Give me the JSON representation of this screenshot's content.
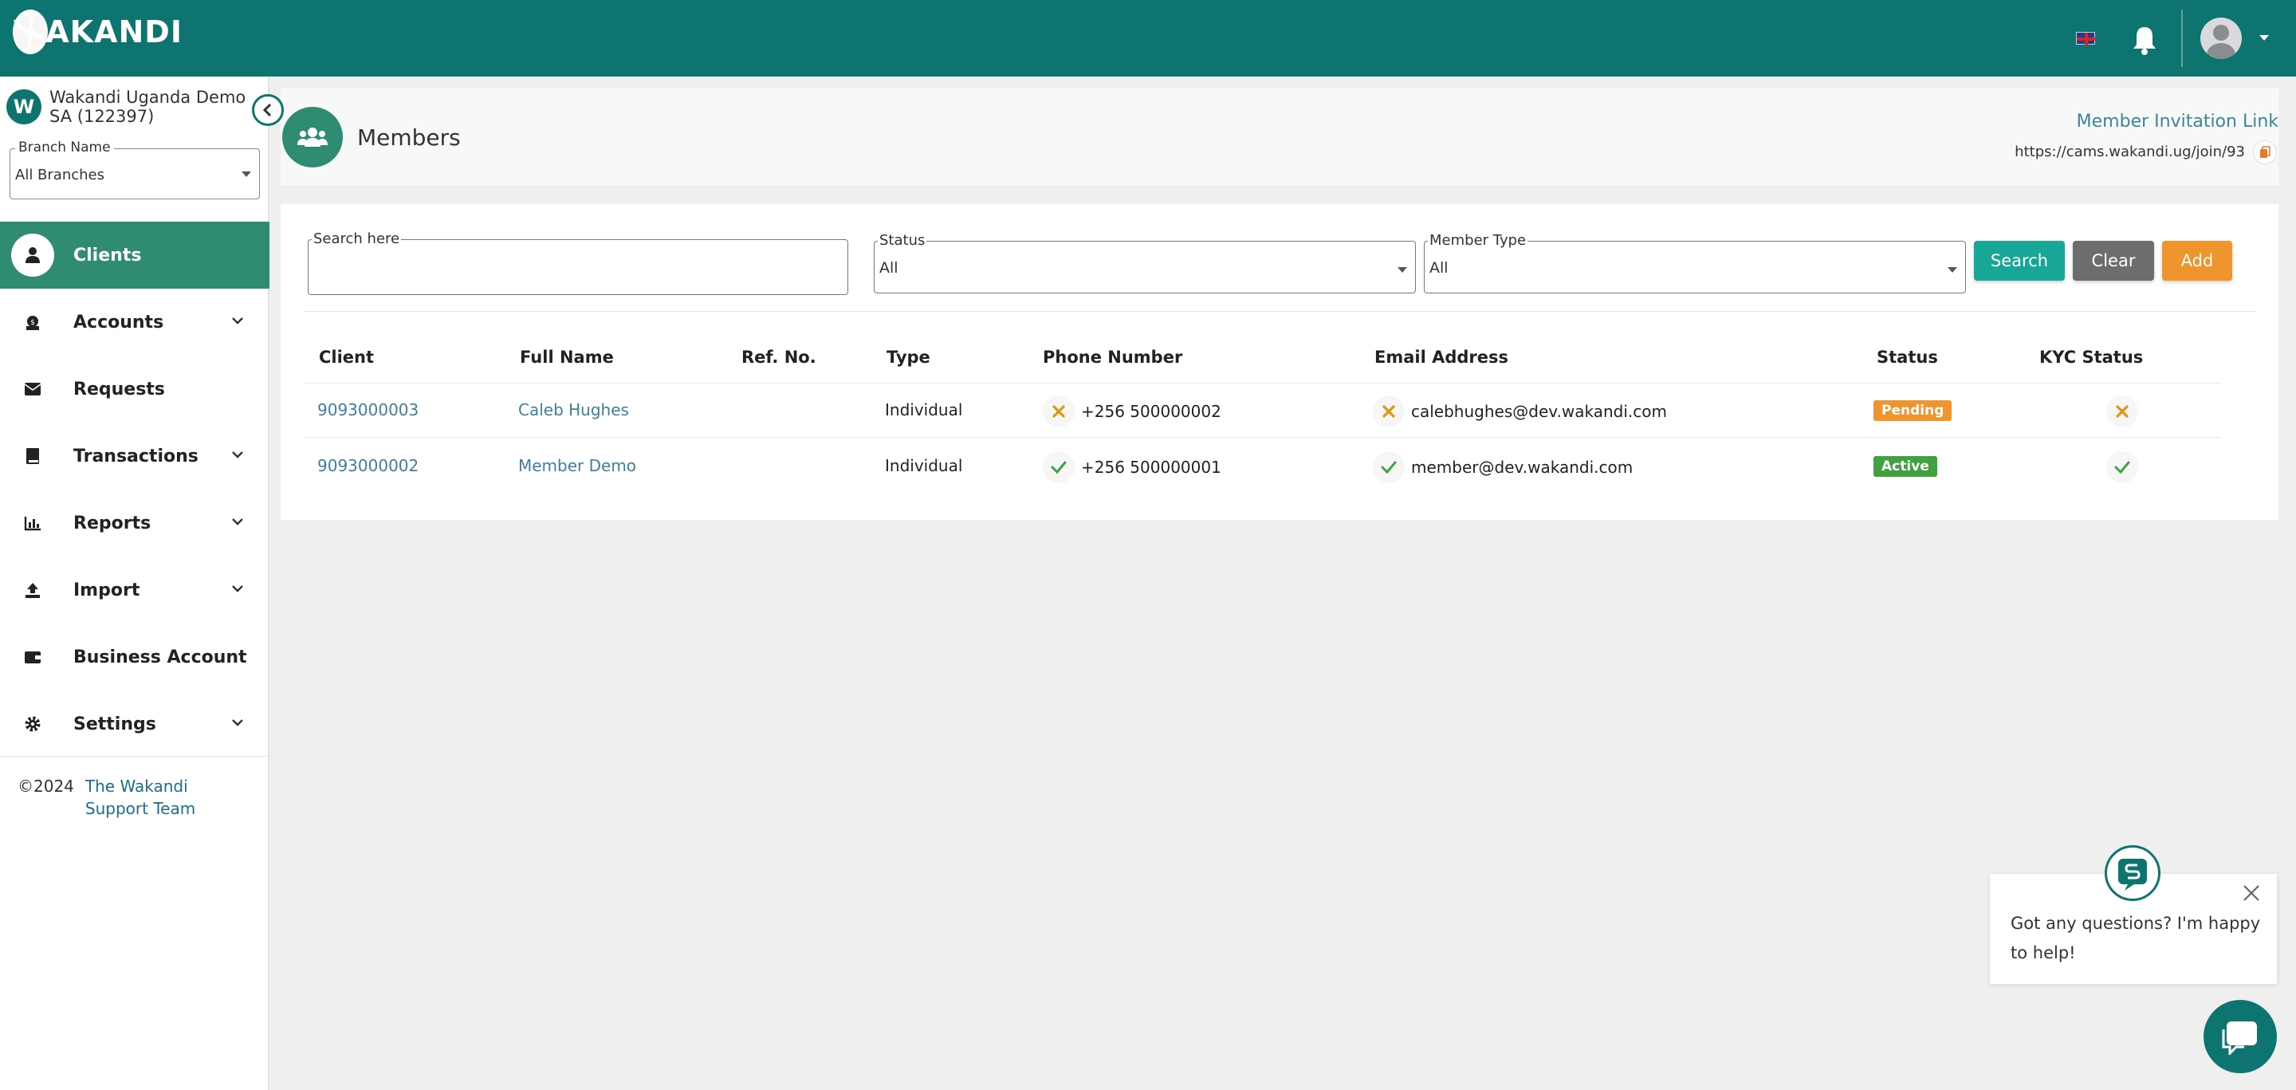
{
  "app": {
    "brand": "WAKANDI"
  },
  "org": {
    "initial": "W",
    "name": "Wakandi Uganda Demo SA (122397)"
  },
  "branch": {
    "label": "Branch Name",
    "value": "All Branches"
  },
  "sidebar": {
    "items": [
      {
        "label": "Clients",
        "icon": "user-icon"
      },
      {
        "label": "Accounts",
        "icon": "money-bag-icon"
      },
      {
        "label": "Requests",
        "icon": "envelope-icon"
      },
      {
        "label": "Transactions",
        "icon": "book-icon"
      },
      {
        "label": "Reports",
        "icon": "bar-chart-icon"
      },
      {
        "label": "Import",
        "icon": "upload-icon"
      },
      {
        "label": "Business Account",
        "icon": "wallet-icon"
      },
      {
        "label": "Settings",
        "icon": "gear-icon"
      }
    ]
  },
  "footer": {
    "copyright": "©2024",
    "link": "The Wakandi Support Team"
  },
  "page": {
    "title": "Members",
    "invite_label": "Member Invitation Link",
    "invite_url": "https://cams.wakandi.ug/join/93"
  },
  "filters": {
    "search_label": "Search here",
    "status_label": "Status",
    "status_value": "All",
    "type_label": "Member Type",
    "type_value": "All",
    "search_btn": "Search",
    "clear_btn": "Clear",
    "add_btn": "Add"
  },
  "table": {
    "headers": [
      "Client",
      "Full Name",
      "Ref. No.",
      "Type",
      "Phone Number",
      "Email Address",
      "Status",
      "KYC Status"
    ],
    "rows": [
      {
        "client": "9093000003",
        "name": "Caleb Hughes",
        "ref": "",
        "type": "Individual",
        "phone": "+256 500000002",
        "phone_verified": false,
        "email": "calebhughes@dev.wakandi.com",
        "email_verified": false,
        "status": "Pending",
        "status_color": "#f0942d",
        "kyc_verified": false
      },
      {
        "client": "9093000002",
        "name": "Member Demo",
        "ref": "",
        "type": "Individual",
        "phone": "+256 500000001",
        "phone_verified": true,
        "email": "member@dev.wakandi.com",
        "email_verified": true,
        "status": "Active",
        "status_color": "#3fa13f",
        "kyc_verified": true
      }
    ]
  },
  "chat": {
    "message": "Got any questions? I'm happy to help!"
  },
  "colors": {
    "primary": "#0e7470",
    "accent": "#2f8c73",
    "success": "#3fa13f",
    "warning": "#f0942d"
  }
}
